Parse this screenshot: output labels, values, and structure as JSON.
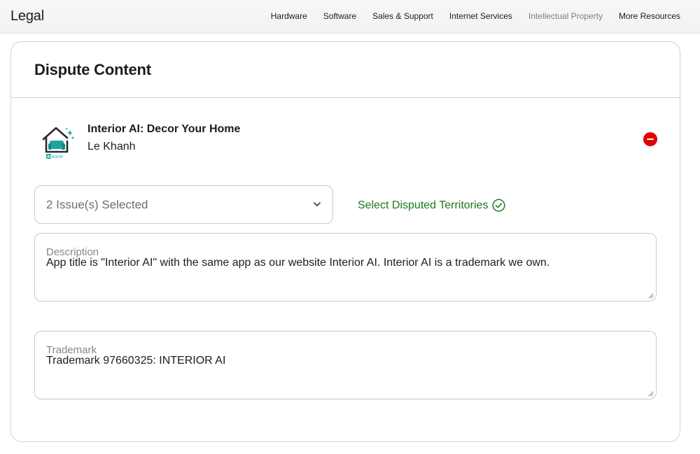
{
  "header": {
    "brand": "Legal",
    "nav": [
      {
        "label": "Hardware"
      },
      {
        "label": "Software"
      },
      {
        "label": "Sales & Support"
      },
      {
        "label": "Internet Services"
      },
      {
        "label": "Intellectual Property",
        "current": true
      },
      {
        "label": "More Resources"
      }
    ]
  },
  "card": {
    "title": "Dispute Content",
    "app": {
      "icon": "interior-ai-app-icon",
      "name": "Interior AI: Decor Your Home",
      "developer": "Le Khanh"
    },
    "issues": {
      "selected_value": "2 Issue(s) Selected"
    },
    "territories": {
      "label": "Select Disputed Territories",
      "icon": "check-circle-icon",
      "color": "#1a7a1a"
    },
    "description": {
      "label": "Description",
      "value": "App title is \"Interior AI\" with the same app as our website Interior AI. Interior AI is a trademark we own."
    },
    "trademark": {
      "label": "Trademark",
      "value": "Trademark 97660325: INTERIOR AI"
    }
  },
  "colors": {
    "remove": "#e30000",
    "border": "#d2d2d7",
    "success": "#1a7a1a"
  }
}
